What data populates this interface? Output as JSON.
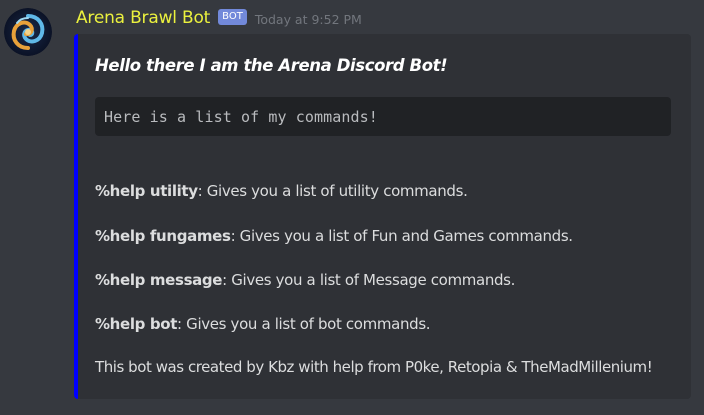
{
  "message": {
    "author": "Arena Brawl Bot",
    "bot_tag": "BOT",
    "timestamp": "Today at 9:52 PM",
    "avatar_icon": "swirl-avatar-icon",
    "author_color": "#ebf13e"
  },
  "embed": {
    "accent_color": "#0000ff",
    "title": "Hello there I am the Arena Discord Bot!",
    "code_block": "Here is a list of my commands!",
    "commands": [
      {
        "command": "%help utility",
        "description": ": Gives you a list of utility commands."
      },
      {
        "command": "%help fungames",
        "description": ": Gives you a list of Fun and Games commands."
      },
      {
        "command": "%help message",
        "description": ": Gives you a list of Message commands."
      },
      {
        "command": "%help bot",
        "description": ": Gives you a list of bot commands."
      }
    ],
    "footer_text": "This bot was created by Kbz with help from P0ke, Retopia & TheMadMillenium!"
  }
}
